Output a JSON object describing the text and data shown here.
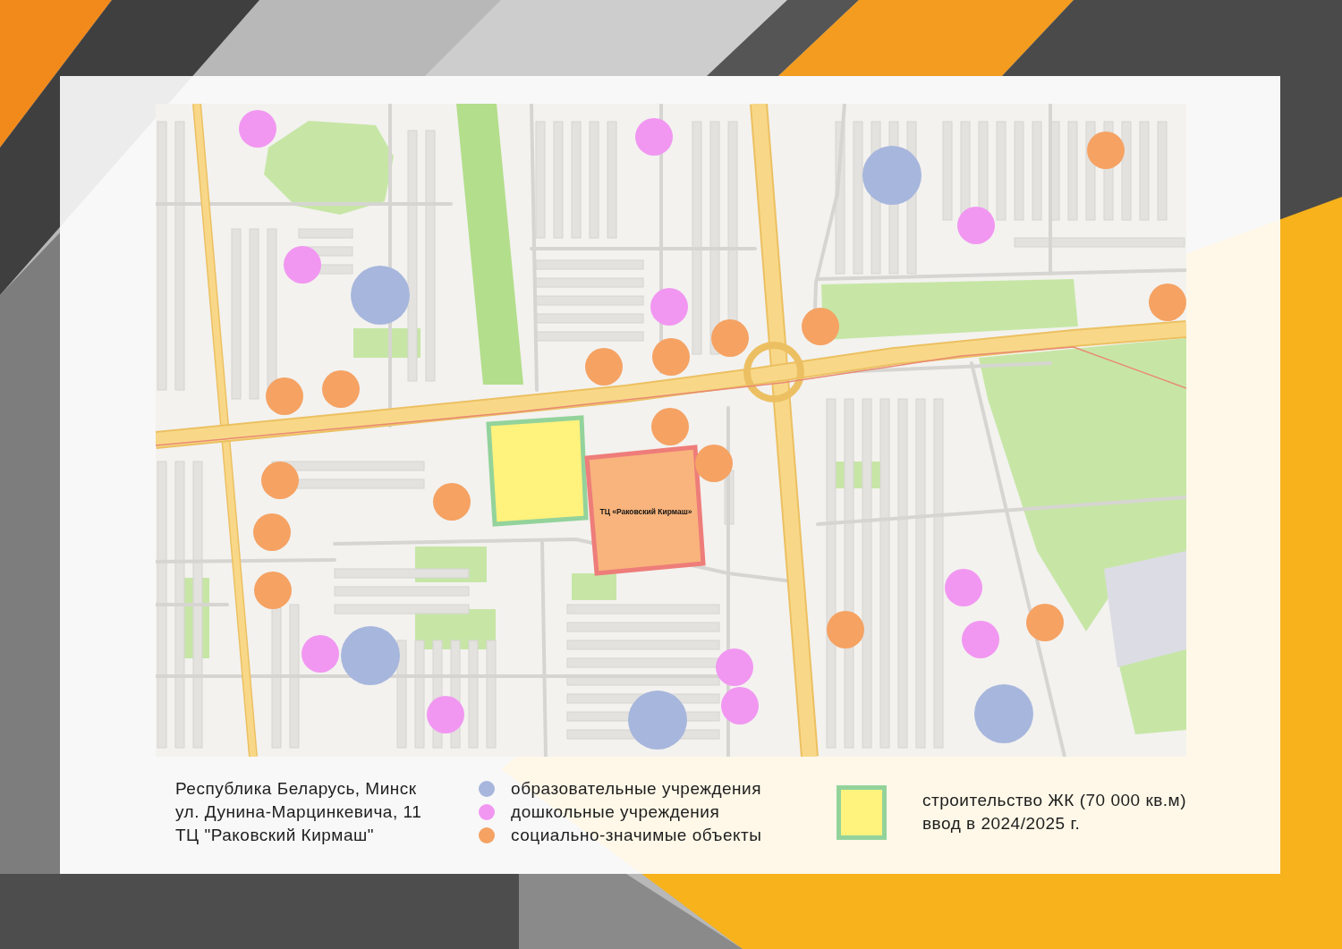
{
  "map": {
    "areas": [
      {
        "kind": "construction"
      },
      {
        "kind": "mall",
        "label": "ТЦ «Раковский Кирмаш»"
      }
    ],
    "markers": [
      {
        "kind": "preschool"
      },
      {
        "kind": "preschool"
      },
      {
        "kind": "social"
      },
      {
        "kind": "education"
      },
      {
        "kind": "preschool"
      },
      {
        "kind": "preschool"
      },
      {
        "kind": "education"
      },
      {
        "kind": "social"
      },
      {
        "kind": "preschool"
      },
      {
        "kind": "social"
      },
      {
        "kind": "social"
      },
      {
        "kind": "social"
      },
      {
        "kind": "social"
      },
      {
        "kind": "social"
      },
      {
        "kind": "social"
      },
      {
        "kind": "social"
      },
      {
        "kind": "social"
      },
      {
        "kind": "social"
      },
      {
        "kind": "social"
      },
      {
        "kind": "social"
      },
      {
        "kind": "preschool"
      },
      {
        "kind": "social"
      },
      {
        "kind": "social"
      },
      {
        "kind": "social"
      },
      {
        "kind": "preschool"
      },
      {
        "kind": "preschool"
      },
      {
        "kind": "education"
      },
      {
        "kind": "preschool"
      },
      {
        "kind": "preschool"
      },
      {
        "kind": "education"
      },
      {
        "kind": "preschool"
      },
      {
        "kind": "education"
      }
    ]
  },
  "legend": {
    "address": [
      "Республика Беларусь, Минск",
      "ул. Дунина-Марцинкевича, 11",
      "ТЦ \"Раковский Кирмаш\""
    ],
    "categories": [
      {
        "kind": "education",
        "label": "образовательные учреждения",
        "color": "#a7b6dc"
      },
      {
        "kind": "preschool",
        "label": "дошкольные учреждения",
        "color": "#f197f1"
      },
      {
        "kind": "social",
        "label": "социально-значимые объекты",
        "color": "#f5a263"
      }
    ],
    "construction": {
      "kind": "construction",
      "lines": [
        "строительство ЖК (70 000 кв.м)",
        "ввод в 2024/2025 г."
      ]
    }
  }
}
